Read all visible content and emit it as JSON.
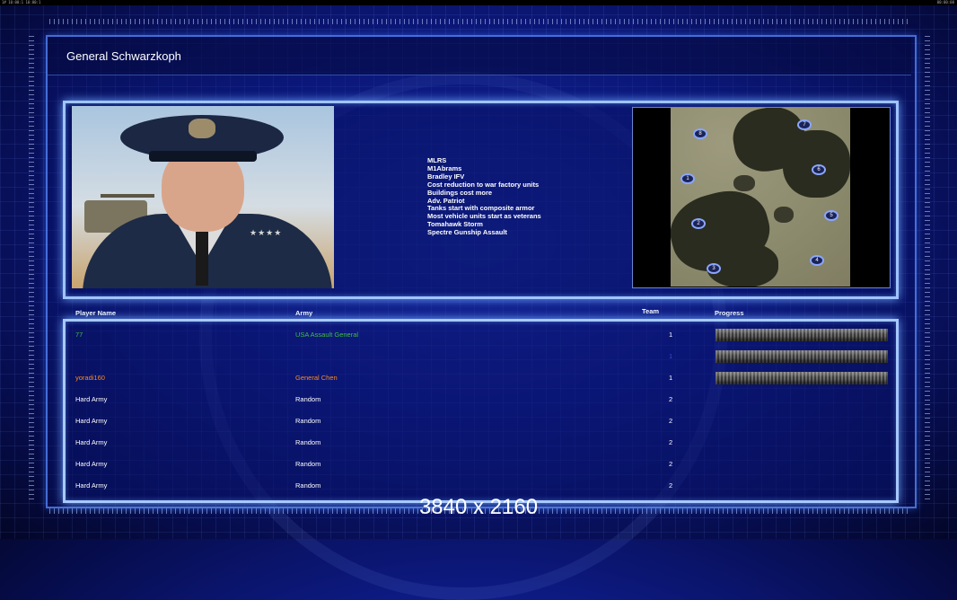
{
  "topbar": {
    "left_text": "1# 10:00:1 10:00:1",
    "right_text": "00:00:00"
  },
  "title": "General Schwarzkoph",
  "features": [
    "MLRS",
    "M1Abrams",
    "Bradley IFV",
    "Cost reduction to war factory units",
    "Buildings cost more",
    "Adv. Patriot",
    "Tanks start with composite armor",
    "Most vehicle units start as veterans",
    "Tomahawk Storm",
    "Spectre Gunship Assault"
  ],
  "map_markers": [
    "1",
    "2",
    "3",
    "4",
    "5",
    "6",
    "7",
    "8"
  ],
  "headers": {
    "player": "Player Name",
    "army": "Army",
    "team": "Team",
    "progress": "Progress"
  },
  "players": [
    {
      "name": "77",
      "army": "USA Assault General",
      "team": "1",
      "color": "#3fbf3f"
    },
    {
      "name": "",
      "army": "",
      "team": "1",
      "color": "#3b47d0"
    },
    {
      "name": "yoradi160",
      "army": "General Chen",
      "team": "1",
      "color": "#ff8a1a"
    },
    {
      "name": "Hard Army",
      "army": "Random",
      "team": "2",
      "color": "#ffffff"
    },
    {
      "name": "Hard Army",
      "army": "Random",
      "team": "2",
      "color": "#ffffff"
    },
    {
      "name": "Hard Army",
      "army": "Random",
      "team": "2",
      "color": "#ffffff"
    },
    {
      "name": "Hard Army",
      "army": "Random",
      "team": "2",
      "color": "#ffffff"
    },
    {
      "name": "Hard Army",
      "army": "Random",
      "team": "2",
      "color": "#ffffff"
    }
  ],
  "resolution_label": "3840 x 2160"
}
